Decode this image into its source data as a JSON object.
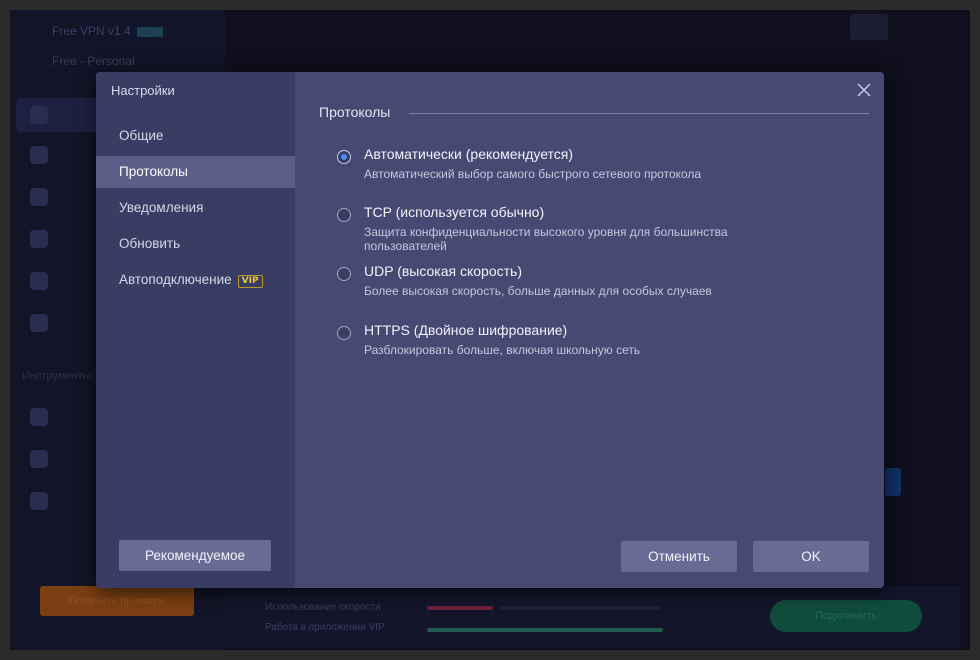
{
  "background_app": {
    "title": "Free VPN v1.4",
    "title_badge": "VIP",
    "mode": "Free - Personal",
    "section_label": "Инструменты",
    "orange_button": "Получить премиум",
    "green_button": "Подключить",
    "bottom_line1": "Использование скорости",
    "bottom_line2": "Работа в приложении VIP"
  },
  "dialog": {
    "title": "Настройки",
    "close_icon": "close-icon",
    "sidebar": {
      "items": [
        {
          "label": "Общие",
          "active": false
        },
        {
          "label": "Протоколы",
          "active": true
        },
        {
          "label": "Уведомления",
          "active": false
        },
        {
          "label": "Обновить",
          "active": false
        },
        {
          "label": "Автоподключение",
          "active": false,
          "badge": "VIP"
        }
      ]
    },
    "recommended_button": "Рекомендуемое",
    "cancel_button": "Отменить",
    "ok_button": "OK",
    "section_title": "Протоколы",
    "protocols": [
      {
        "title": "Автоматически (рекомендуется)",
        "description": "Автоматический выбор самого быстрого сетевого протокола",
        "checked": true
      },
      {
        "title": "TCP (используется обычно)",
        "description": "Защита конфиденциальности высокого уровня для большинства пользователей",
        "checked": false
      },
      {
        "title": "UDP (высокая скорость)",
        "description": "Более высокая скорость, больше данных для особых случаев",
        "checked": false
      },
      {
        "title": "HTTPS (Двойное шифрование)",
        "description": "Разблокировать больше, включая школьную сеть",
        "checked": false
      }
    ]
  },
  "colors": {
    "modal_bg": "#464a72",
    "modal_sidebar_bg": "#393c63",
    "active_item_bg": "#5a5e88",
    "button_bg": "#686c95",
    "radio_accent": "#4f8df5",
    "vip_badge": "#e6c640"
  }
}
